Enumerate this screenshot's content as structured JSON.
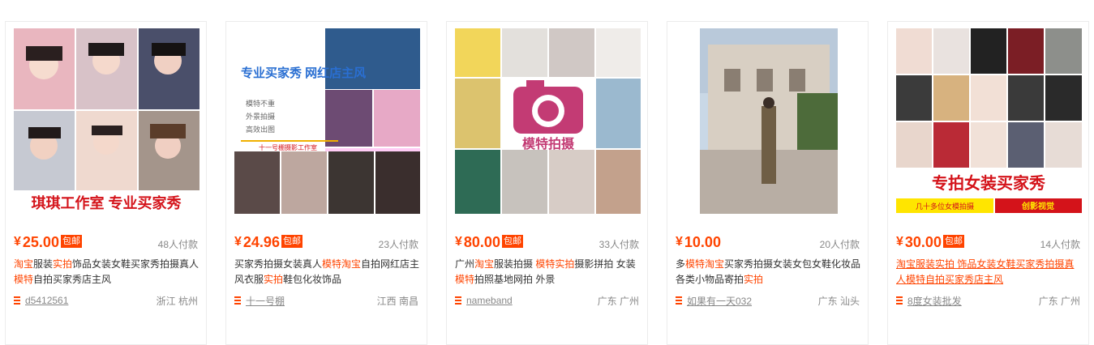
{
  "colors": {
    "accent": "#ff4400",
    "muted": "#888888"
  },
  "items": [
    {
      "image_caption": "琪琪工作室 专业买家秀",
      "currency": "¥",
      "price": "25.00",
      "badge": "包邮",
      "buyers": "48人付款",
      "title_parts": [
        [
          "淘宝",
          true
        ],
        [
          "服装",
          false
        ],
        [
          "实拍",
          true
        ],
        [
          "饰品女装女鞋买家秀拍摄真人",
          false
        ],
        [
          "模特",
          true
        ],
        [
          "自拍买家秀店主风",
          false
        ]
      ],
      "shop_icon": "list-icon",
      "shop": "d5412561",
      "location": "浙江 杭州"
    },
    {
      "image_caption": "专业买家秀 网红店主风",
      "image_sub": [
        "模特不重",
        "外景拍摄",
        "高效出图"
      ],
      "image_brand": "十一号棚摄影工作室",
      "currency": "¥",
      "price": "24.96",
      "badge": "包邮",
      "buyers": "23人付款",
      "title_parts": [
        [
          "买家秀拍摄女装真人",
          false
        ],
        [
          "模特",
          true
        ],
        [
          "淘宝",
          true
        ],
        [
          "自拍网红店主风衣服",
          false
        ],
        [
          "实拍",
          true
        ],
        [
          "鞋包化妆饰品",
          false
        ]
      ],
      "shop_icon": "list-icon",
      "shop": "十一号棚",
      "location": "江西 南昌"
    },
    {
      "image_caption": "模特拍摄",
      "currency": "¥",
      "price": "80.00",
      "badge": "包邮",
      "buyers": "33人付款",
      "title_parts": [
        [
          "广州",
          false
        ],
        [
          "淘宝",
          true
        ],
        [
          "服装拍摄 ",
          false
        ],
        [
          "模特实拍",
          true
        ],
        [
          "摄影拼拍 女装",
          false
        ],
        [
          "模特",
          true
        ],
        [
          "拍照基地网拍 外景",
          false
        ]
      ],
      "shop_icon": "list-icon",
      "shop": "nameband",
      "location": "广东 广州"
    },
    {
      "image_caption": "",
      "currency": "¥",
      "price": "10.00",
      "badge": "",
      "buyers": "20人付款",
      "title_parts": [
        [
          "多",
          false
        ],
        [
          "模特淘宝",
          true
        ],
        [
          "买家秀拍摄女装女包女鞋化妆品各类小物品寄拍",
          false
        ],
        [
          "实拍",
          true
        ]
      ],
      "shop_icon": "list-icon",
      "shop": "如果有一天032",
      "location": "广东 汕头"
    },
    {
      "image_caption": "专拍女装买家秀",
      "image_sub": [
        "几十多位女模拍摄",
        "创影视觉"
      ],
      "currency": "¥",
      "price": "30.00",
      "badge": "包邮",
      "buyers": "14人付款",
      "title_parts": [
        [
          "淘宝服装实拍 饰品女装女鞋买家秀拍摄真人模特自拍买家秀店主风",
          true
        ]
      ],
      "title_underlined": true,
      "shop_icon": "list-icon",
      "shop": "8度女装批发",
      "location": "广东 广州"
    }
  ]
}
